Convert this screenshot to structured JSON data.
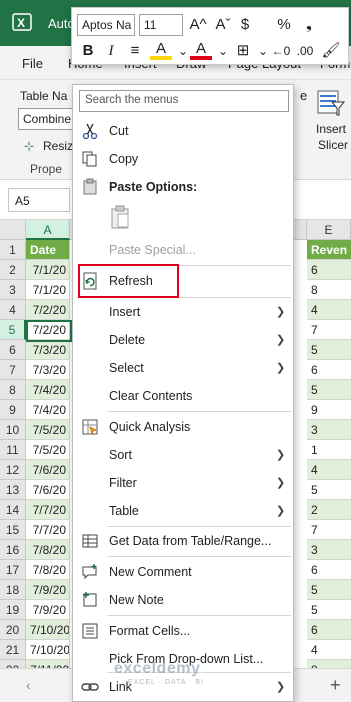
{
  "window": {
    "title": "Auto"
  },
  "ribbon": {
    "tabs": [
      "File",
      "Home",
      "Insert",
      "Draw",
      "Page Layout",
      "Form"
    ],
    "table_name_label": "Table Na",
    "table_name_value": "Combine",
    "resize_label": "Resiz",
    "properties_label": "Prope",
    "insert_slicer_label1": "Insert",
    "insert_slicer_label2": "Slicer",
    "edge_text": "e"
  },
  "name_box": {
    "value": "A5"
  },
  "grid": {
    "col_a": "A",
    "col_e": "E",
    "rows": [
      {
        "n": "1",
        "a": "Date",
        "e": "Reven"
      },
      {
        "n": "2",
        "a": "7/1/20",
        "e": "6"
      },
      {
        "n": "3",
        "a": "7/1/20",
        "e": "8"
      },
      {
        "n": "4",
        "a": "7/2/20",
        "e": "4"
      },
      {
        "n": "5",
        "a": "7/2/20",
        "e": "7"
      },
      {
        "n": "6",
        "a": "7/3/20",
        "e": "5"
      },
      {
        "n": "7",
        "a": "7/3/20",
        "e": "6"
      },
      {
        "n": "8",
        "a": "7/4/20",
        "e": "5"
      },
      {
        "n": "9",
        "a": "7/4/20",
        "e": "9"
      },
      {
        "n": "10",
        "a": "7/5/20",
        "e": "3"
      },
      {
        "n": "11",
        "a": "7/5/20",
        "e": "1"
      },
      {
        "n": "12",
        "a": "7/6/20",
        "e": "4"
      },
      {
        "n": "13",
        "a": "7/6/20",
        "e": "5"
      },
      {
        "n": "14",
        "a": "7/7/20",
        "e": "2"
      },
      {
        "n": "15",
        "a": "7/7/20",
        "e": "7"
      },
      {
        "n": "16",
        "a": "7/8/20",
        "e": "3"
      },
      {
        "n": "17",
        "a": "7/8/20",
        "e": "6"
      },
      {
        "n": "18",
        "a": "7/9/20",
        "e": "5"
      },
      {
        "n": "19",
        "a": "7/9/20",
        "e": "5"
      },
      {
        "n": "20",
        "a": "7/10/20",
        "e": "6"
      },
      {
        "n": "21",
        "a": "7/10/20",
        "e": "4"
      },
      {
        "n": "22",
        "a": "7/11/20",
        "e": "8"
      }
    ]
  },
  "mini_toolbar": {
    "font": "Aptos Na",
    "size": "11",
    "grow": "A^",
    "shrink": "Aˇ",
    "currency": "$",
    "percent": "%",
    "comma": "❟",
    "bold": "B",
    "italic": "I",
    "align": "≡",
    "fill": "A",
    "fontcolor": "A",
    "borders": "⊞",
    "inc_dec": "←0",
    "dec_dec": ".00",
    "painter": "🖌"
  },
  "context_menu": {
    "search_placeholder": "Search the menus",
    "items": {
      "cut": "Cut",
      "copy": "Copy",
      "paste_options": "Paste Options:",
      "paste_special": "Paste Special...",
      "refresh": "Refresh",
      "insert": "Insert",
      "delete": "Delete",
      "select": "Select",
      "clear_contents": "Clear Contents",
      "quick_analysis": "Quick Analysis",
      "sort": "Sort",
      "filter": "Filter",
      "table": "Table",
      "get_data": "Get Data from Table/Range...",
      "new_comment": "New Comment",
      "new_note": "New Note",
      "format_cells": "Format Cells...",
      "pick_list": "Pick From Drop-down List...",
      "link": "Link"
    }
  },
  "watermark": {
    "main": "exceldemy",
    "sub": "EXCEL · DATA · BI"
  },
  "colors": {
    "excel_green": "#217346",
    "header_green": "#70ad47",
    "band": "#e2efda",
    "highlight": "#e0001b"
  }
}
